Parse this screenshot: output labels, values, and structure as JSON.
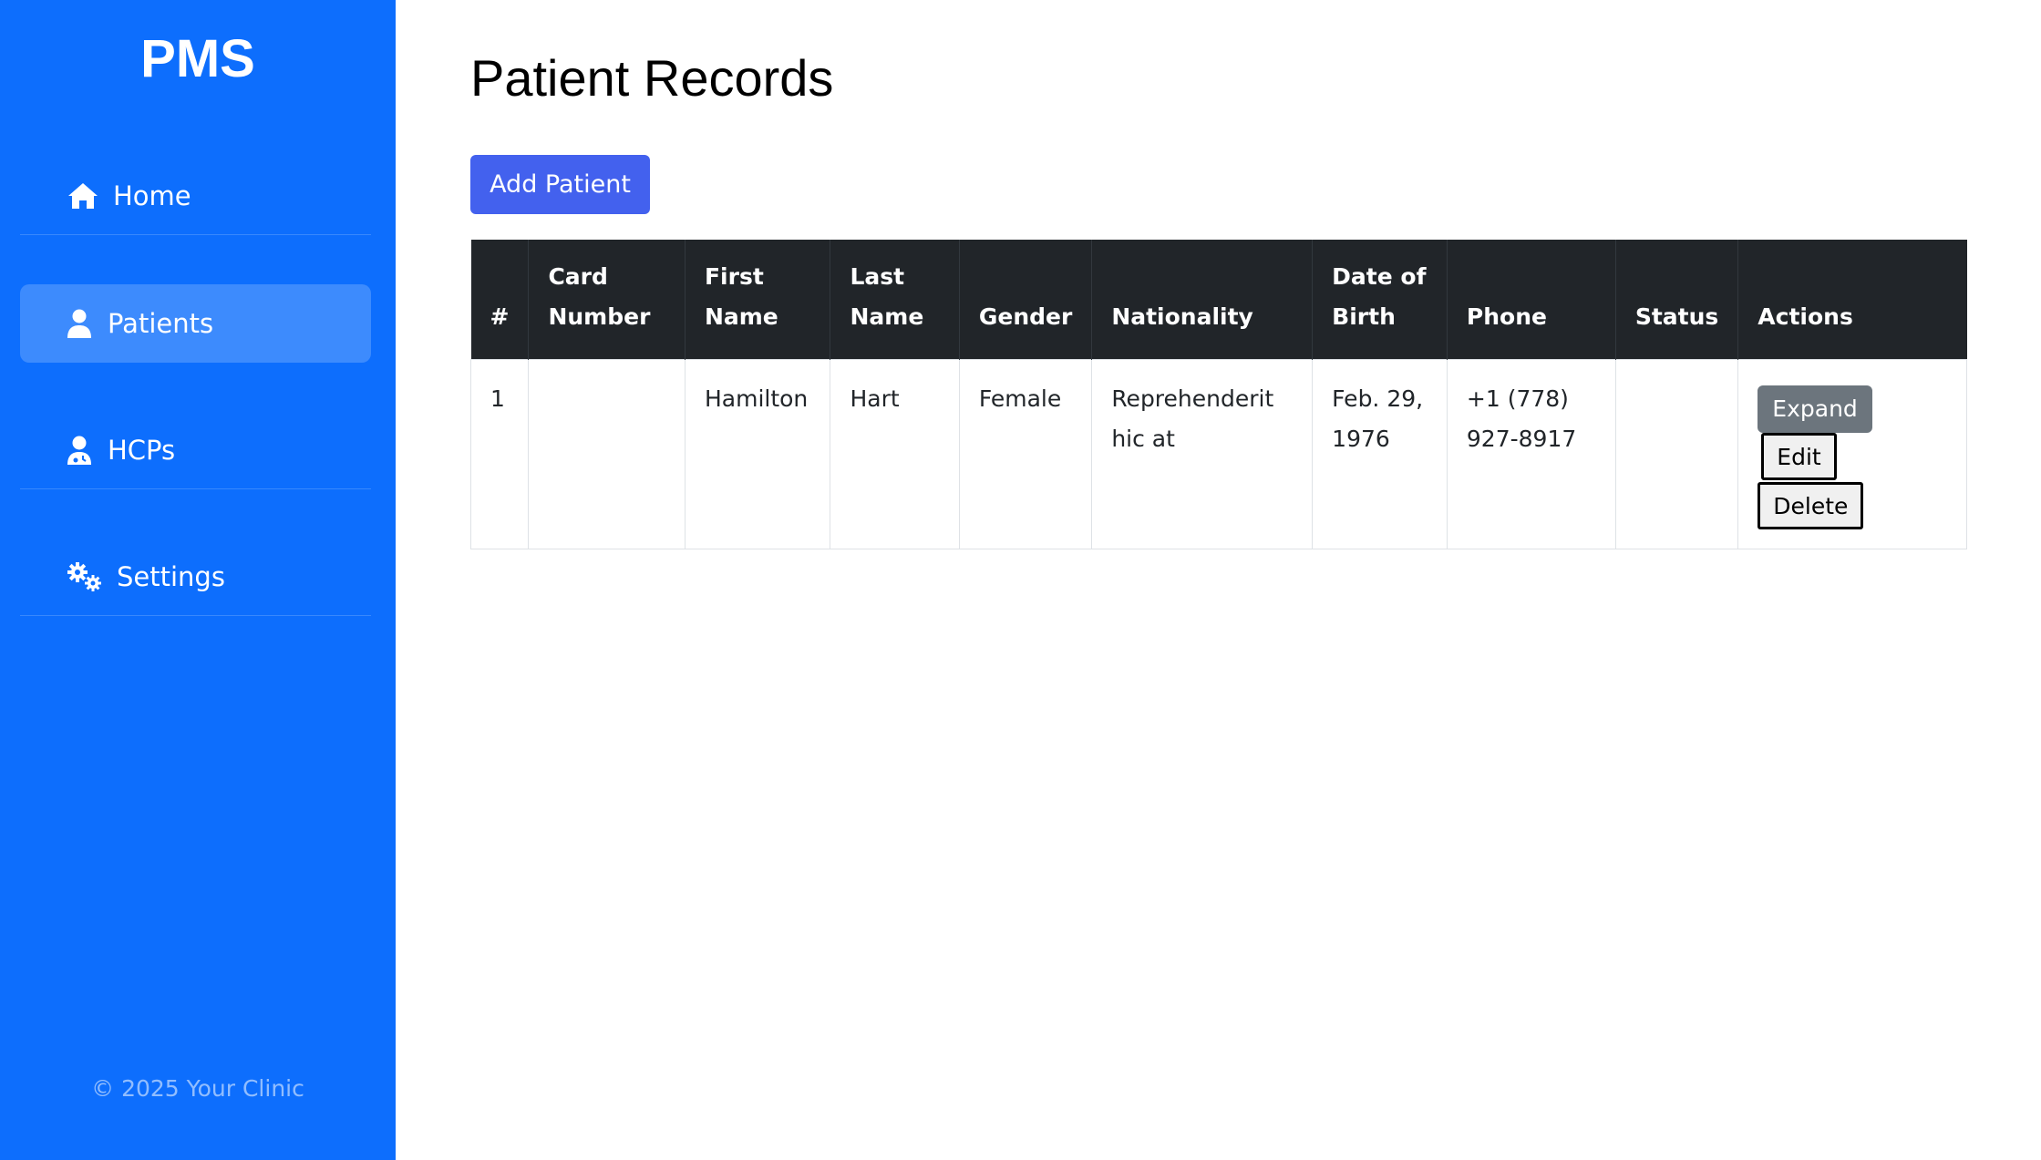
{
  "sidebar": {
    "brand": "PMS",
    "items": [
      {
        "label": "Home",
        "icon": "home-icon",
        "active": false
      },
      {
        "label": "Patients",
        "icon": "user-icon",
        "active": true
      },
      {
        "label": "HCPs",
        "icon": "user-doctor-icon",
        "active": false
      },
      {
        "label": "Settings",
        "icon": "gears-icon",
        "active": false
      }
    ],
    "footer": "© 2025 Your Clinic"
  },
  "main": {
    "title": "Patient Records",
    "add_button": "Add Patient",
    "table": {
      "headers": {
        "num": "#",
        "card": [
          "Card",
          "Number"
        ],
        "first": [
          "First",
          "Name"
        ],
        "last": [
          "Last",
          "Name"
        ],
        "gender": "Gender",
        "nationality": "Nationality",
        "dob": [
          "Date of",
          "Birth"
        ],
        "phone": "Phone",
        "status": "Status",
        "actions": "Actions"
      },
      "rows": [
        {
          "num": "1",
          "card_number": "",
          "first_name": "Hamilton",
          "last_name": "Hart",
          "gender": "Female",
          "nationality": [
            "Reprehenderit",
            "hic at"
          ],
          "dob": [
            "Feb. 29,",
            "1976"
          ],
          "phone": [
            "+1 (778)",
            "927-8917"
          ],
          "status": "",
          "actions": {
            "expand": "Expand",
            "edit": "Edit",
            "delete": "Delete"
          }
        }
      ]
    }
  },
  "colors": {
    "sidebar_bg": "#0d6efd",
    "active_item_bg": "#3d8bfd",
    "primary_button": "#4361ee",
    "table_header_bg": "#212529",
    "expand_button": "#6c757d"
  }
}
